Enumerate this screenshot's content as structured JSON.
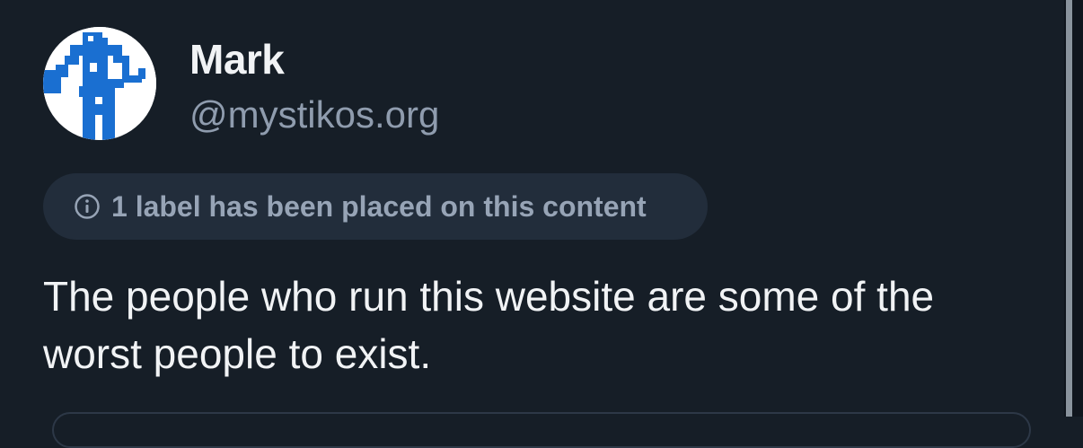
{
  "post": {
    "author": {
      "display_name": "Mark",
      "handle": "@mystikos.org",
      "avatar_icon": "blue-white-pixel-figure-avatar"
    },
    "moderation_label": {
      "icon": "info-circle-icon",
      "text": "1 label has been placed on this content"
    },
    "text": "The people who run this website are some of the worst people to exist."
  },
  "colors": {
    "background": "#161e27",
    "text_primary": "#f1f3f5",
    "text_secondary": "#8f9cae",
    "label_pill_bg": "#222d3b",
    "avatar_blue": "#1a6fd1"
  }
}
